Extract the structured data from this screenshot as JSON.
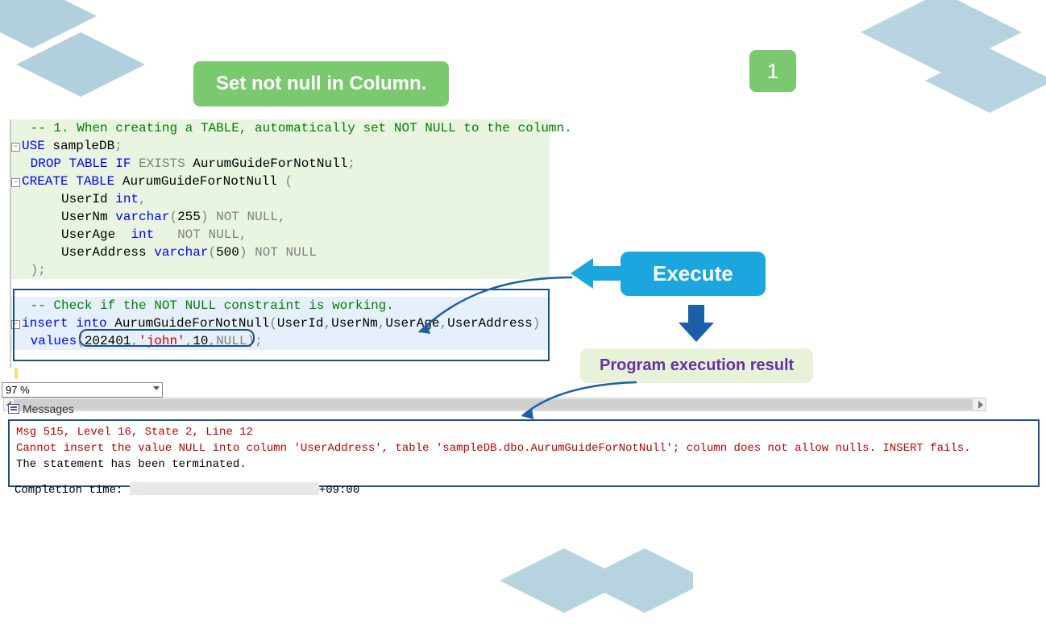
{
  "title_badge": "Set not null in Column.",
  "step_number": "1",
  "execute_label": "Execute",
  "result_label": "Program execution result",
  "code": {
    "c1": "-- 1. When creating a TABLE, automatically set NOT NULL to the column.",
    "l2a": "USE",
    "l2b": " sampleDB",
    "l2c": ";",
    "l3a": "DROP",
    "l3b": "TABLE",
    "l3c": "IF",
    "l3d": "EXISTS",
    "l3e": " AurumGuideForNotNull",
    "l3f": ";",
    "l4a": "CREATE",
    "l4b": "TABLE",
    "l4c": " AurumGuideForNotNull ",
    "l4d": "(",
    "l5a": "    UserId ",
    "l5b": "int",
    "l5c": ",",
    "l6a": "    UserNm ",
    "l6b": "varchar",
    "l6c": "(",
    "l6d": "255",
    "l6e": ")",
    "l6f": "NOT",
    "l6g": "NULL",
    "l6h": ",",
    "l7a": "    UserAge  ",
    "l7b": "int",
    "l7c": "NOT",
    "l7d": "NULL",
    "l7e": ",",
    "l8a": "    UserAddress ",
    "l8b": "varchar",
    "l8c": "(",
    "l8d": "500",
    "l8e": ")",
    "l8f": "NOT",
    "l8g": "NULL",
    "l9a": ")",
    "l9b": ";",
    "c10": " -- Check if the NOT NULL constraint is working.",
    "l11a": "insert",
    "l11b": "into",
    "l11c": " AurumGuideForNotNull",
    "l11d": "(",
    "l11e": "UserId",
    "l11f": ",",
    "l11g": "UserNm",
    "l11h": ",",
    "l11i": "UserAge",
    "l11j": ",",
    "l11k": "UserAddress",
    "l11l": ")",
    "l12a": "values",
    "l12b": "(",
    "l12c": "202401",
    "l12d": ",",
    "l12e": "'john'",
    "l12f": ",",
    "l12g": "10",
    "l12h": ",",
    "l12i": "NULL",
    "l12j": ")",
    "l12k": ";"
  },
  "zoom": "97 %",
  "messages_tab": "Messages",
  "messages": {
    "line1": "Msg 515, Level 16, State 2, Line 12",
    "line2": "Cannot insert the value NULL into column 'UserAddress', table 'sampleDB.dbo.AurumGuideForNotNull'; column does not allow nulls. INSERT fails.",
    "line3": "The statement has been terminated."
  },
  "completion_prefix": "Completion time: ",
  "completion_suffix": "+09:00"
}
